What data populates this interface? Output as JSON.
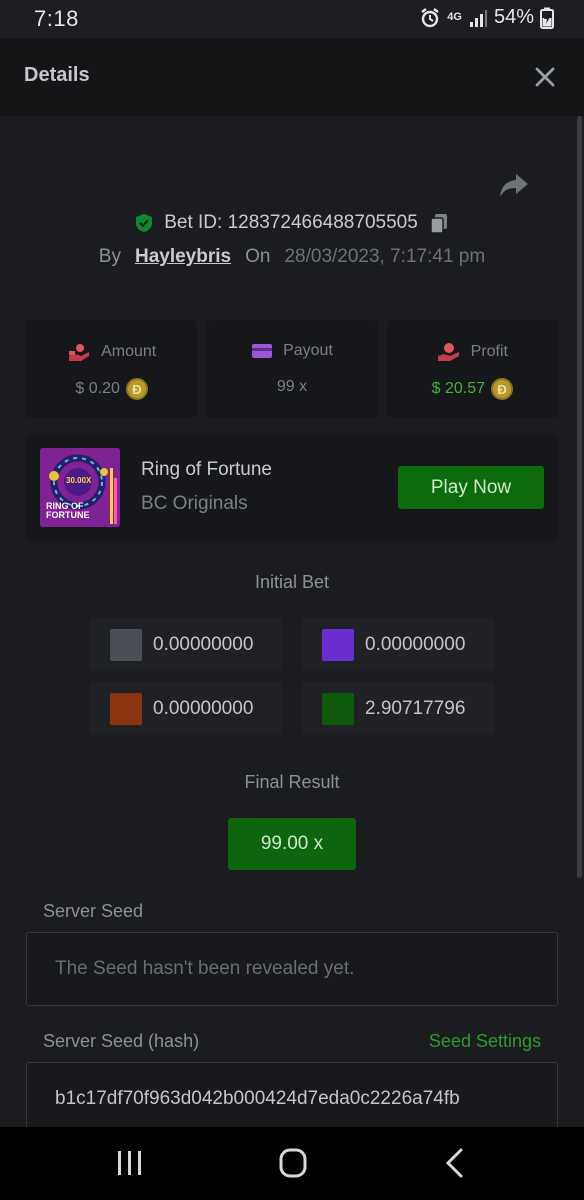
{
  "status_bar": {
    "time": "7:18",
    "network": "4G",
    "battery": "54%"
  },
  "header": {
    "title": "Details",
    "close_icon": "close-icon"
  },
  "bet": {
    "id_label": "Bet ID: 128372466488705505",
    "by_label": "By",
    "user": "Hayleybris",
    "on_label": "On",
    "date": "28/03/2023, 7:17:41 pm"
  },
  "stats": {
    "amount": {
      "label": "Amount",
      "value": "$ 0.20"
    },
    "payout": {
      "label": "Payout",
      "value": "99 x"
    },
    "profit": {
      "label": "Profit",
      "value": "$ 20.57"
    }
  },
  "game": {
    "name": "Ring of Fortune",
    "provider": "BC Originals",
    "play_label": "Play Now",
    "thumb_multiplier": "30.00X",
    "thumb_title_1": "RING OF",
    "thumb_title_2": "FORTUNE"
  },
  "initial_bet": {
    "title": "Initial Bet",
    "cells": [
      {
        "color": "#4a4f56",
        "value": "0.00000000"
      },
      {
        "color": "#6a2ed0",
        "value": "0.00000000"
      },
      {
        "color": "#8a3510",
        "value": "0.00000000"
      },
      {
        "color": "#0d5a0d",
        "value": "2.90717796"
      }
    ]
  },
  "final_result": {
    "title": "Final Result",
    "value": "99.00 x"
  },
  "server_seed": {
    "label": "Server Seed",
    "placeholder": "The Seed hasn't been revealed yet."
  },
  "server_seed_hash": {
    "label": "Server Seed (hash)",
    "settings_link": "Seed Settings",
    "value": "b1c17df70f963d042b000424d7eda0c2226a74fb"
  },
  "colors": {
    "accent_green": "#0c6b0c",
    "profit_green": "#3fb339",
    "background": "#1b1c1f"
  }
}
